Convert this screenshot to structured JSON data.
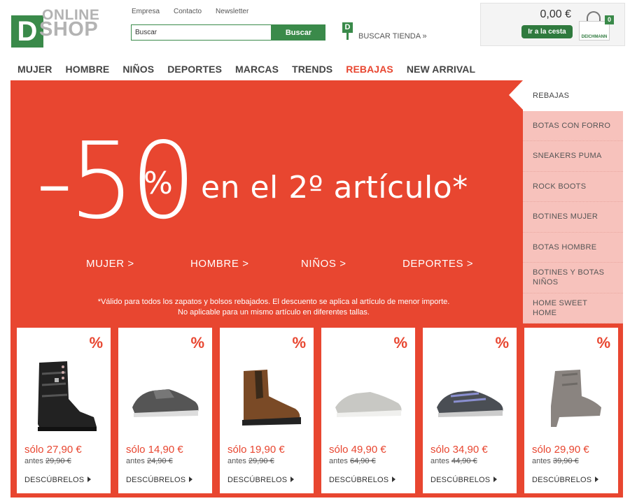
{
  "logo": {
    "letter": "D",
    "line1": "ONLINE",
    "line2": "SHOP"
  },
  "toplinks": [
    "Empresa",
    "Contacto",
    "Newsletter"
  ],
  "search": {
    "placeholder": "Buscar",
    "button": "Buscar"
  },
  "store": {
    "pin_letter": "D",
    "label": "BUSCAR TIENDA »"
  },
  "cart": {
    "total": "0,00 €",
    "button": "Ir a la cesta",
    "count": "0",
    "brand": "DEICHMANN"
  },
  "nav": [
    {
      "label": "MUJER",
      "active": false
    },
    {
      "label": "HOMBRE",
      "active": false
    },
    {
      "label": "NIÑOS",
      "active": false
    },
    {
      "label": "DEPORTES",
      "active": false
    },
    {
      "label": "MARCAS",
      "active": false
    },
    {
      "label": "TRENDS",
      "active": false
    },
    {
      "label": "REBAJAS",
      "active": true
    },
    {
      "label": "NEW ARRIVAL",
      "active": false
    }
  ],
  "hero": {
    "big": "-50",
    "pct": "%",
    "text": "en el 2º artículo*",
    "links": [
      "MUJER >",
      "HOMBRE >",
      "NIÑOS >",
      "DEPORTES >"
    ],
    "disclaimer_line1": "*Válido para todos los zapatos y bolsos rebajados. El descuento se aplica al artículo de menor importe.",
    "disclaimer_line2": "No aplicable para un mismo artículo en diferentes tallas."
  },
  "sidebar": [
    "REBAJAS",
    "BOTAS CON FORRO",
    "SNEAKERS PUMA",
    "ROCK BOOTS",
    "BOTINES MUJER",
    "BOTAS HOMBRE",
    "BOTINES Y BOTAS NIÑOS",
    "HOME SWEET HOME"
  ],
  "products": [
    {
      "price": "sólo 27,90 €",
      "before_label": "antes",
      "before": "29,90 €",
      "cta": "DESCÚBRELOS",
      "badge": "%",
      "shoe": "biker-boot-icon"
    },
    {
      "price": "sólo 14,90 €",
      "before_label": "antes",
      "before": "24,90 €",
      "cta": "DESCÚBRELOS",
      "badge": "%",
      "shoe": "sneaker-grey-icon"
    },
    {
      "price": "sólo 19,90 €",
      "before_label": "antes",
      "before": "29,90 €",
      "cta": "DESCÚBRELOS",
      "badge": "%",
      "shoe": "chelsea-boot-icon"
    },
    {
      "price": "sólo 49,90 €",
      "before_label": "antes",
      "before": "64,90 €",
      "cta": "DESCÚBRELOS",
      "badge": "%",
      "shoe": "sneaker-light-icon"
    },
    {
      "price": "sólo 34,90 €",
      "before_label": "antes",
      "before": "44,90 €",
      "cta": "DESCÚBRELOS",
      "badge": "%",
      "shoe": "running-shoe-icon"
    },
    {
      "price": "sólo 29,90 €",
      "before_label": "antes",
      "before": "39,90 €",
      "cta": "DESCÚBRELOS",
      "badge": "%",
      "shoe": "ankle-boot-icon"
    }
  ],
  "colors": {
    "brand_green": "#3a8a4a",
    "promo_red": "#e84630",
    "sidebar_pink": "#f7c2bc"
  }
}
